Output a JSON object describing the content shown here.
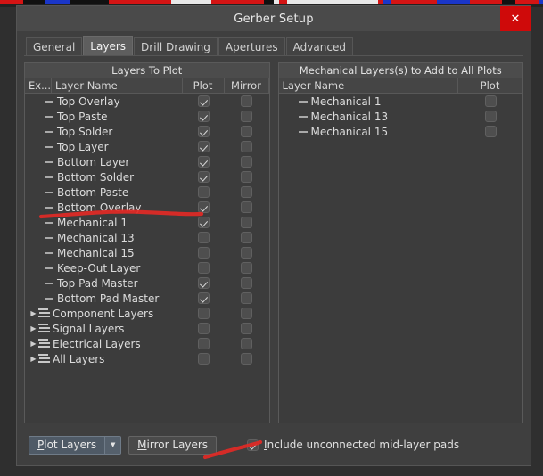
{
  "window": {
    "title": "Gerber Setup",
    "close_label": "✕"
  },
  "tabs": [
    {
      "label": "General",
      "active": false
    },
    {
      "label": "Layers",
      "active": true
    },
    {
      "label": "Drill Drawing",
      "active": false
    },
    {
      "label": "Apertures",
      "active": false
    },
    {
      "label": "Advanced",
      "active": false
    }
  ],
  "left_panel": {
    "title": "Layers To Plot",
    "columns": [
      "Ex...",
      "Layer Name",
      "Plot",
      "Mirror"
    ],
    "rows": [
      {
        "name": "Top Overlay",
        "type": "layer",
        "plot": true,
        "mirror": false
      },
      {
        "name": "Top Paste",
        "type": "layer",
        "plot": true,
        "mirror": false
      },
      {
        "name": "Top Solder",
        "type": "layer",
        "plot": true,
        "mirror": false
      },
      {
        "name": "Top Layer",
        "type": "layer",
        "plot": true,
        "mirror": false
      },
      {
        "name": "Bottom Layer",
        "type": "layer",
        "plot": true,
        "mirror": false
      },
      {
        "name": "Bottom Solder",
        "type": "layer",
        "plot": true,
        "mirror": false
      },
      {
        "name": "Bottom Paste",
        "type": "layer",
        "plot": false,
        "mirror": false
      },
      {
        "name": "Bottom Overlay",
        "type": "layer",
        "plot": true,
        "mirror": false
      },
      {
        "name": "Mechanical 1",
        "type": "layer",
        "plot": true,
        "mirror": false
      },
      {
        "name": "Mechanical 13",
        "type": "layer",
        "plot": false,
        "mirror": false
      },
      {
        "name": "Mechanical 15",
        "type": "layer",
        "plot": false,
        "mirror": false
      },
      {
        "name": "Keep-Out Layer",
        "type": "layer",
        "plot": false,
        "mirror": false
      },
      {
        "name": "Top Pad Master",
        "type": "layer",
        "plot": true,
        "mirror": false
      },
      {
        "name": "Bottom Pad Master",
        "type": "layer",
        "plot": true,
        "mirror": false
      },
      {
        "name": "Component Layers",
        "type": "group",
        "plot": false,
        "mirror": false
      },
      {
        "name": "Signal Layers",
        "type": "group",
        "plot": false,
        "mirror": false
      },
      {
        "name": "Electrical Layers",
        "type": "group",
        "plot": false,
        "mirror": false
      },
      {
        "name": "All Layers",
        "type": "group",
        "plot": false,
        "mirror": false
      }
    ]
  },
  "right_panel": {
    "title": "Mechanical Layers(s) to Add to All Plots",
    "columns": [
      "Layer Name",
      "Plot"
    ],
    "rows": [
      {
        "name": "Mechanical 1",
        "type": "layer",
        "plot": false
      },
      {
        "name": "Mechanical 13",
        "type": "layer",
        "plot": false
      },
      {
        "name": "Mechanical 15",
        "type": "layer",
        "plot": false
      }
    ]
  },
  "bottom": {
    "plot_layers_label": "Plot Layers",
    "plot_layers_accel": "P",
    "dropdown_glyph": "▼",
    "mirror_layers_label": "Mirror Layers",
    "mirror_layers_accel": "M",
    "include_pads_label": "nclude unconnected mid-layer pads",
    "include_pads_accel": "I",
    "include_pads_checked": true
  },
  "annotations": {
    "stroke_color": "#e02a26",
    "marks": [
      {
        "name": "underline-mechanical-13"
      },
      {
        "name": "underline-include-pads"
      }
    ]
  },
  "colors": {
    "dialog_bg": "#3f3f3f",
    "panel_bg": "#3c3c3c",
    "titlebar_bg": "#4a4a4a",
    "close_btn": "#cf0a0a",
    "accent_button": "#4f5a66",
    "text": "#dcdcdc"
  }
}
